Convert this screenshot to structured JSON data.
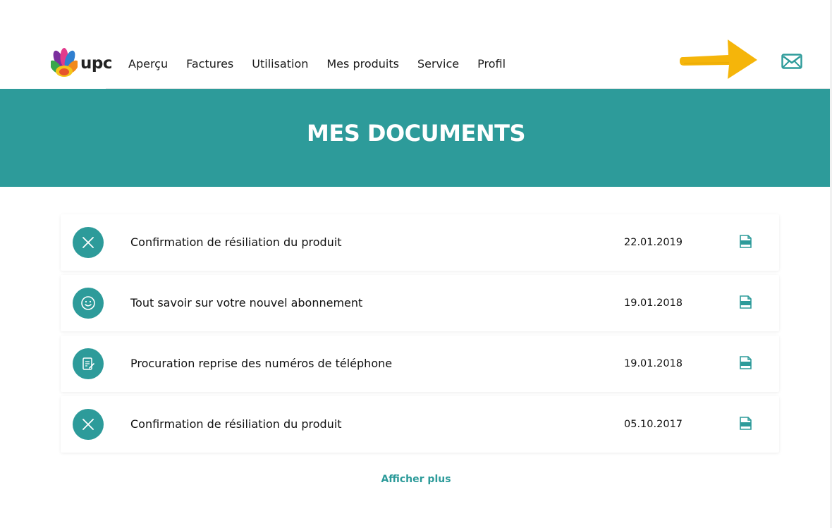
{
  "header": {
    "logo_text": "upc",
    "nav": [
      "Aperçu",
      "Factures",
      "Utilisation",
      "Mes produits",
      "Service",
      "Profil"
    ]
  },
  "banner": {
    "title": "MES DOCUMENTS"
  },
  "documents": [
    {
      "icon": "close-icon",
      "title": "Confirmation de résiliation du produit",
      "date": "22.01.2019"
    },
    {
      "icon": "smiley-icon",
      "title": "Tout savoir sur votre nouvel abonnement",
      "date": "19.01.2018"
    },
    {
      "icon": "document-sign-icon",
      "title": "Procuration reprise des numéros de téléphone",
      "date": "19.01.2018"
    },
    {
      "icon": "close-icon",
      "title": "Confirmation de résiliation du produit",
      "date": "05.10.2017"
    }
  ],
  "more_label": "Afficher plus",
  "colors": {
    "accent": "#2d9b9a",
    "arrow": "#f5b50a"
  }
}
